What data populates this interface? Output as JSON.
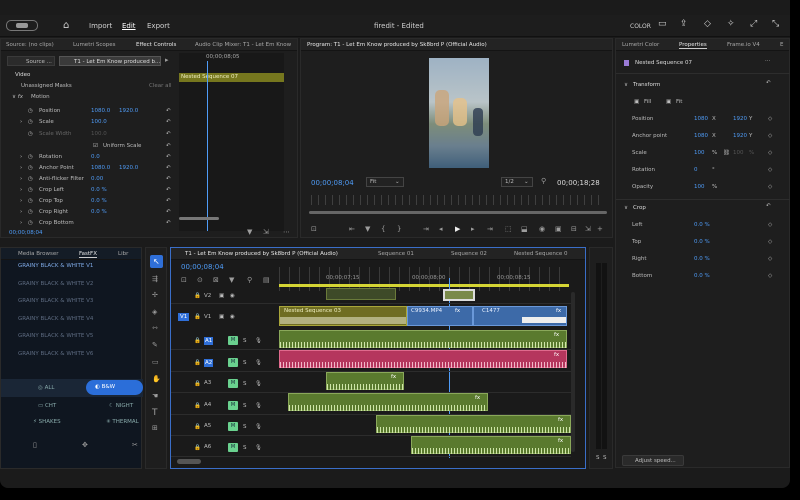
{
  "topbar": {
    "import": "Import",
    "edit": "Edit",
    "export": "Export",
    "title": "firedit - Edited",
    "color": "COLOR"
  },
  "source_panel": {
    "tabs": [
      "Source: (no clips)",
      "Lumetri Scopes",
      "Effect Controls",
      "Audio Clip Mixer: T1 - Let Em Know"
    ],
    "master": "Source ...",
    "clip": "T1 - Let Em Know produced b...",
    "video": "Video",
    "unassigned": "Unassigned Masks",
    "clear_all": "Clear all",
    "motion": "Motion",
    "props": [
      {
        "label": "Position",
        "v1": "1080.0",
        "v2": "1920.0"
      },
      {
        "label": "Scale",
        "v1": "100.0",
        "v2": ""
      },
      {
        "label": "Scale Width",
        "v1": "100.0",
        "v2": ""
      },
      {
        "label": "Uniform Scale",
        "v1": "",
        "v2": ""
      },
      {
        "label": "Rotation",
        "v1": "0.0",
        "v2": ""
      },
      {
        "label": "Anchor Point",
        "v1": "1080.0",
        "v2": "1920.0"
      },
      {
        "label": "Anti-flicker Filter",
        "v1": "0.00",
        "v2": ""
      },
      {
        "label": "Crop Left",
        "v1": "0.0 %",
        "v2": ""
      },
      {
        "label": "Crop Top",
        "v1": "0.0 %",
        "v2": ""
      },
      {
        "label": "Crop Right",
        "v1": "0.0 %",
        "v2": ""
      },
      {
        "label": "Crop Bottom",
        "v1": "",
        "v2": ""
      }
    ],
    "mini_time": "00;00;08;05",
    "nested": "Nested Sequence 07",
    "timecode": "00;00;08;04"
  },
  "program": {
    "title": "Program: T1 - Let Em Know produced by Sk8brd P (Official Audio)",
    "timecode": "00;00;08;04",
    "fit": "Fit",
    "ratio": "1/2",
    "duration": "00;00;18;28"
  },
  "properties": {
    "tabs": [
      "Lumetri Color",
      "Properties",
      "Frame.io V4",
      "E"
    ],
    "name": "Nested Sequence 07",
    "transform": "Transform",
    "fill": "Fill",
    "fit": "Fit",
    "rows": [
      {
        "label": "Position",
        "v1": "1080",
        "u1": "X",
        "v2": "1920",
        "u2": "Y"
      },
      {
        "label": "Anchor point",
        "v1": "1080",
        "u1": "X",
        "v2": "1920",
        "u2": "Y"
      },
      {
        "label": "Scale",
        "v1": "100",
        "u1": "%",
        "v2": "100",
        "u2": "%"
      },
      {
        "label": "Rotation",
        "v1": "0",
        "u1": "°",
        "v2": "",
        "u2": ""
      },
      {
        "label": "Opacity",
        "v1": "100",
        "u1": "%",
        "v2": "",
        "u2": ""
      }
    ],
    "crop": "Crop",
    "crop_rows": [
      {
        "label": "Left",
        "v": "0.0 %"
      },
      {
        "label": "Top",
        "v": "0.0 %"
      },
      {
        "label": "Right",
        "v": "0.0 %"
      },
      {
        "label": "Bottom",
        "v": "0.0 %"
      }
    ],
    "adjust": "Adjust speed..."
  },
  "media": {
    "tabs": [
      "Media Browser",
      "FastFX",
      "Libr"
    ],
    "items": [
      "GRAINY BLACK & WHITE V1",
      "GRAINY BLACK & WHITE V2",
      "GRAINY BLACK & WHITE V3",
      "GRAINY BLACK & WHITE V4",
      "GRAINY BLACK & WHITE V5",
      "GRAINY BLACK & WHITE V6"
    ],
    "all": "ALL",
    "bw": "B&W",
    "cht": "CHT",
    "night": "NIGHT",
    "shakes": "SHAKES",
    "thermal": "THERMAL"
  },
  "timeline": {
    "tabs": [
      "T1 - Let Em Know produced by Sk8brd P (Official Audio)",
      "Sequence 01",
      "Sequence 02",
      "Nested Sequence 0"
    ],
    "timecode": "00;00;08;04",
    "ruler": [
      "00;00;07;15",
      "00;00;08;00",
      "00;00;08;15"
    ],
    "v_tracks": [
      "V2",
      "V1"
    ],
    "a_tracks": [
      "A1",
      "A2",
      "A3",
      "A4",
      "A5",
      "A6"
    ],
    "clips": {
      "nested": "Nested Sequence 03",
      "c1": "C9934.MP4",
      "c2": "C1477"
    }
  },
  "meter": {
    "s1": "S",
    "s2": "S"
  }
}
